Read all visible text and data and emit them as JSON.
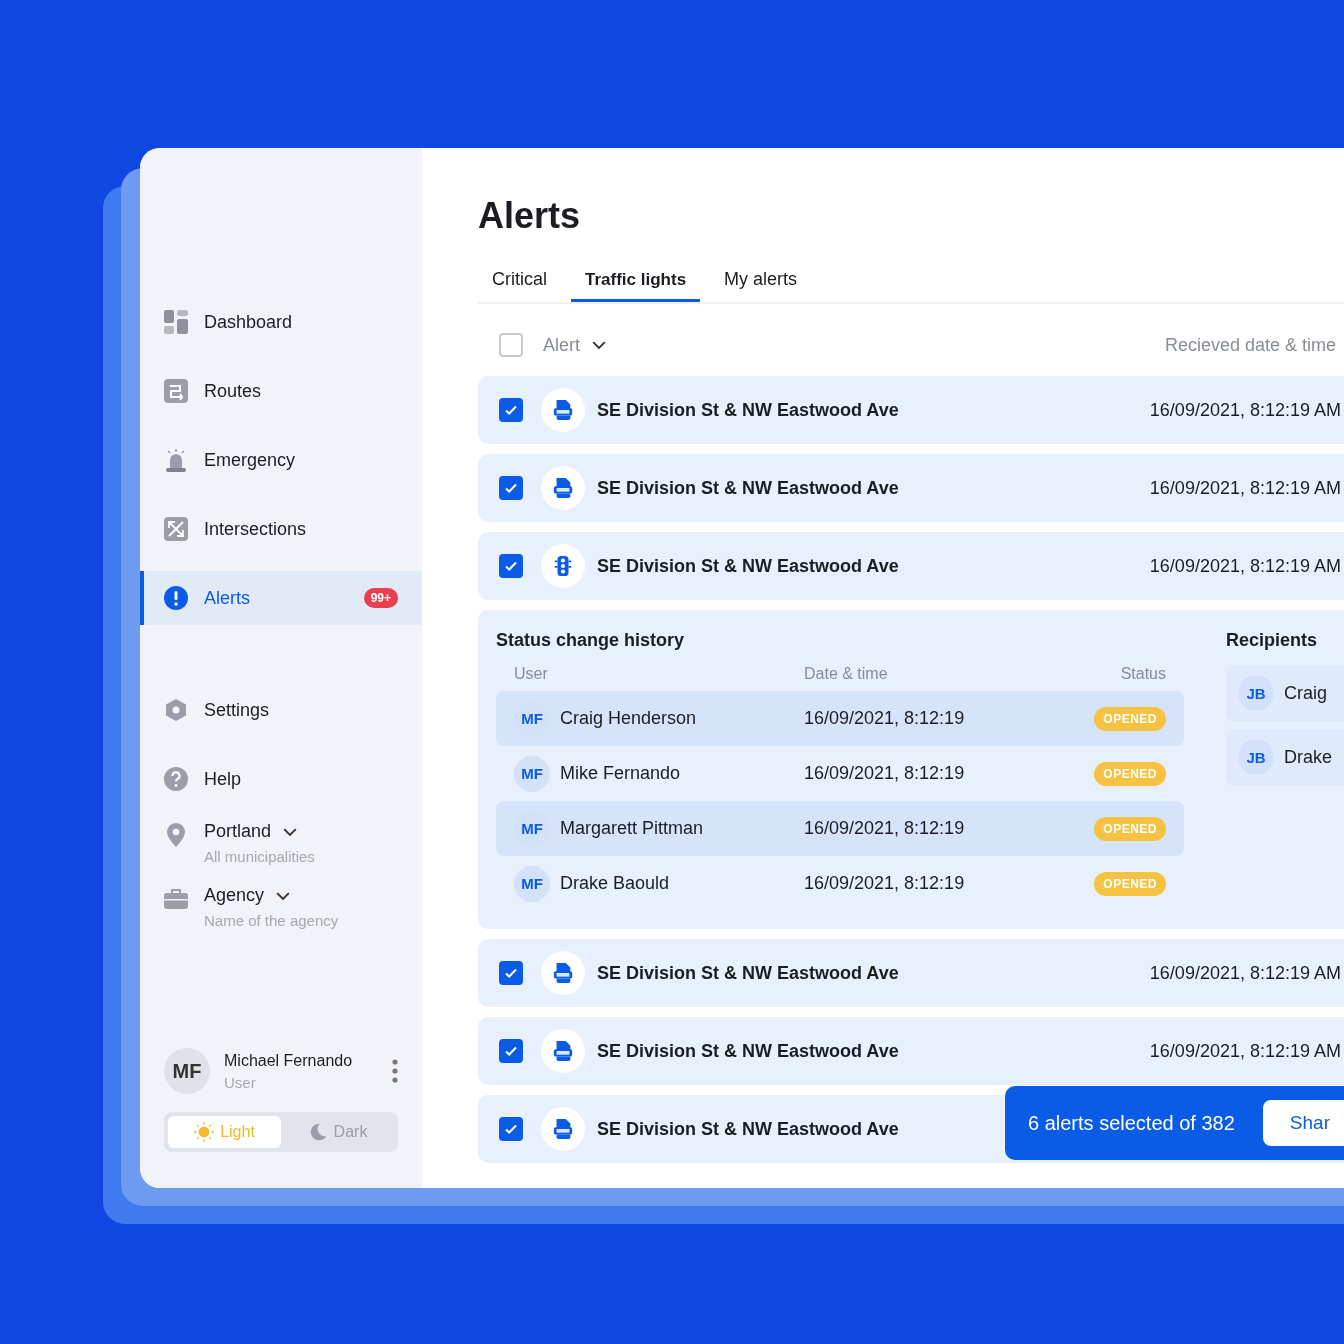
{
  "sidebar": {
    "nav": [
      {
        "label": "Dashboard",
        "kind": "dashboard",
        "selected": false
      },
      {
        "label": "Routes",
        "kind": "routes",
        "selected": false
      },
      {
        "label": "Emergency",
        "kind": "siren",
        "selected": false
      },
      {
        "label": "Intersections",
        "kind": "intersection",
        "selected": false
      },
      {
        "label": "Alerts",
        "kind": "alert",
        "selected": true,
        "badge": "99+"
      }
    ],
    "secondary": [
      {
        "label": "Settings",
        "kind": "settings"
      },
      {
        "label": "Help",
        "kind": "help"
      }
    ],
    "selectors": [
      {
        "label": "Portland",
        "subtitle": "All municipalities",
        "kind": "pin"
      },
      {
        "label": "Agency",
        "subtitle": "Name of the agency",
        "kind": "briefcase"
      }
    ],
    "user": {
      "initials": "MF",
      "name": "Michael Fernando",
      "role": "User"
    },
    "theme": [
      {
        "label": "Light",
        "kind": "sun",
        "selected": true
      },
      {
        "label": "Dark",
        "kind": "moon",
        "selected": false
      }
    ]
  },
  "title": "Alerts",
  "tabs": [
    {
      "label": "Critical",
      "selected": false
    },
    {
      "label": "Traffic lights",
      "selected": true
    },
    {
      "label": "My alerts",
      "selected": false
    }
  ],
  "table": {
    "header": {
      "checked": false,
      "alert": "Alert",
      "received": "Recieved date & time"
    },
    "rows": [
      {
        "checked": true,
        "kind": "log",
        "name": "SE Division St & NW Eastwood Ave",
        "date": "16/09/2021, 8:12:19 AM"
      },
      {
        "checked": true,
        "kind": "log",
        "name": "SE Division St & NW Eastwood Ave",
        "date": "16/09/2021, 8:12:19 AM"
      },
      {
        "checked": true,
        "kind": "traffic-light",
        "name": "SE Division St & NW Eastwood Ave",
        "date": "16/09/2021, 8:12:19 AM",
        "details": {
          "history_title": "Status change history",
          "columns": [
            "User",
            "Date & time",
            "Status"
          ],
          "history": [
            {
              "initials": "MF",
              "user": "Craig Henderson",
              "date": "16/09/2021, 8:12:19",
              "status": "OPENED"
            },
            {
              "initials": "MF",
              "user": "Mike Fernando",
              "date": "16/09/2021, 8:12:19",
              "status": "OPENED"
            },
            {
              "initials": "MF",
              "user": "Margarett Pittman",
              "date": "16/09/2021, 8:12:19",
              "status": "OPENED"
            },
            {
              "initials": "MF",
              "user": "Drake Baould",
              "date": "16/09/2021, 8:12:19",
              "status": "OPENED"
            }
          ],
          "recipients_title": "Recipients",
          "recipients": [
            {
              "initials": "JB",
              "name": "Craig"
            },
            {
              "initials": "JB",
              "name": "Drake"
            }
          ]
        }
      },
      {
        "checked": true,
        "kind": "log",
        "name": "SE Division St & NW Eastwood Ave",
        "date": "16/09/2021, 8:12:19 AM"
      },
      {
        "checked": true,
        "kind": "log",
        "name": "SE Division St & NW Eastwood Ave",
        "date": "16/09/2021, 8:12:19 AM"
      },
      {
        "checked": true,
        "kind": "log",
        "name": "SE Division St & NW Eastwood Ave"
      }
    ]
  },
  "selection_bar": {
    "text": "6 alerts selected of 382",
    "button": "Shar"
  }
}
